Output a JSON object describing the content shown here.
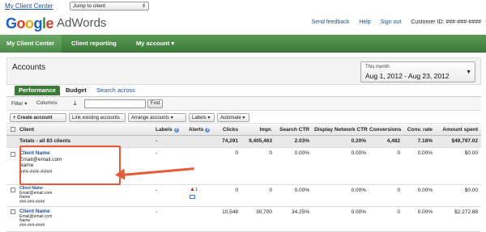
{
  "topbar": {
    "mcc_link": "My Client Center",
    "jump_select": "Jump to client"
  },
  "header": {
    "logo_google": [
      "G",
      "o",
      "o",
      "g",
      "l",
      "e"
    ],
    "logo_product": "AdWords",
    "links": [
      "Send feedback",
      "Help",
      "Sign out"
    ],
    "customer_id": "Customer ID: ###-###-####"
  },
  "nav": {
    "items": [
      "My Client Center",
      "Client reporting",
      "My account ▾"
    ]
  },
  "accounts": {
    "title": "Accounts",
    "date_label": "This month",
    "date_value": "Aug 1, 2012 - Aug 23, 2012"
  },
  "tabs": [
    "Performance",
    "Budget",
    "Search across accounts"
  ],
  "filters": {
    "filter": "Filter ▾",
    "columns": "Columns",
    "find_placeholder": "",
    "find_button": "Find"
  },
  "actions": [
    "+ Create account",
    "Link existing accounts",
    "Arrange accounts ▾",
    "Labels ▾",
    "Automate ▾"
  ],
  "table": {
    "headers": {
      "client": "Client",
      "labels": "Labels",
      "alerts": "Alerts",
      "clicks": "Clicks",
      "impr": "Impr.",
      "sctr": "Search CTR",
      "dnctr": "Display Network CTR",
      "conv": "Conversions",
      "crate": "Conv. rate",
      "spent": "Amount spent"
    },
    "totals": {
      "client": "Totals - all 83 clients",
      "labels": "-",
      "clicks": "74,291",
      "impr": "9,405,463",
      "sctr": "2.03%",
      "dnctr": "0.20%",
      "conv": "4,482",
      "crate": "7.18%",
      "spent": "$49,797.02"
    },
    "rows": [
      {
        "name": "Client Name",
        "email": "Email@email.com",
        "contact": "Name",
        "phone": "###-###-####",
        "labels": "-",
        "alert_count": "",
        "clicks": "0",
        "impr": "0",
        "sctr": "0.00%",
        "dnctr": "0.00%",
        "conv": "0",
        "crate": "0.00%",
        "spent": "$0.00"
      },
      {
        "name": "Client Name",
        "email": "Email@email.com",
        "contact": "Name",
        "phone": "###-###-####",
        "labels": "-",
        "alert_count": "1",
        "clicks": "0",
        "impr": "0",
        "sctr": "0.00%",
        "dnctr": "0.00%",
        "conv": "0",
        "crate": "0.00%",
        "spent": "$0.00"
      },
      {
        "name": "Client Name",
        "email": "Email@email.com",
        "contact": "Name",
        "phone": "###-###-####",
        "labels": "-",
        "alert_count": "",
        "clicks": "10,548",
        "impr": "30,700",
        "sctr": "34.25%",
        "dnctr": "0.00%",
        "conv": "0",
        "crate": "0.00%",
        "spent": "$2,272.88"
      }
    ]
  },
  "colors": {
    "nav_green": "#3d7a39",
    "link_blue": "#1a4f9c",
    "annotation": "#e85a3a",
    "alert_red": "#d2261c"
  }
}
